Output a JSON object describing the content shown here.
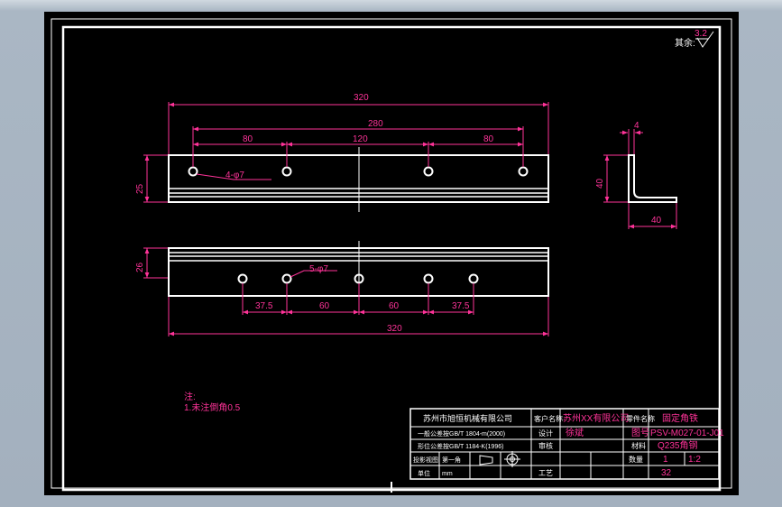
{
  "drawing": {
    "roughness_label": "其余:",
    "roughness_value": "3.2",
    "top_view": {
      "dims": [
        "320",
        "280",
        "80",
        "120",
        "80",
        "25"
      ],
      "hole_note": "4-φ7"
    },
    "bottom_view": {
      "dims": [
        "26",
        "37.5",
        "60",
        "60",
        "37.5",
        "320"
      ],
      "hole_note": "5-φ7"
    },
    "side_view": {
      "dims": [
        "4",
        "40",
        "40"
      ]
    },
    "notes": [
      "注:",
      "1.未注倒角0.5"
    ]
  },
  "title_block": {
    "company": "苏州市旭恒机械有限公司",
    "std1": "一般公差按GB/T 1804-m(2000)",
    "std2": "形位公差按GB/T 1184-K(1996)",
    "r_proj_label": "投影视图",
    "r_proj_value": "第一角",
    "customer_label": "客户名称",
    "customer_value": "苏州XX有限公司",
    "design_label": "设计",
    "design_value": "徐斌",
    "review_label": "审核",
    "process_label": "工艺",
    "unit_label": "单位",
    "unit_value": "mm",
    "part_name_label": "零件名称",
    "part_name_value": "固定角铁",
    "drawing_no_label": "图号",
    "drawing_no_value": "PSV-M027-01-J01",
    "material_label": "材料",
    "material_value": "Q235角钢",
    "qty_label": "数量",
    "qty_value": "1",
    "scale_value": "1:2",
    "sheet_value": "32"
  }
}
